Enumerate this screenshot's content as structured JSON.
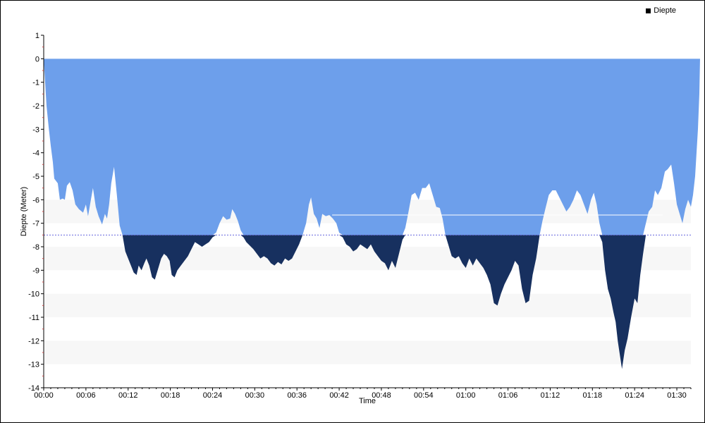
{
  "chart_data": {
    "type": "area",
    "title": "",
    "xlabel": "Time",
    "ylabel": "Diepte (Meter)",
    "legend": {
      "position": "top-right",
      "label": "Diepte"
    },
    "x_unit": "minutes",
    "xlim": [
      0,
      92
    ],
    "ylim": [
      -14,
      1
    ],
    "x_ticks": [
      "00:00",
      "00:06",
      "00:12",
      "00:18",
      "00:24",
      "00:30",
      "00:36",
      "00:42",
      "00:48",
      "00:54",
      "01:00",
      "01:06",
      "01:12",
      "01:18",
      "01:24",
      "01:30"
    ],
    "y_ticks": [
      "1",
      "0",
      "-1",
      "-2",
      "-3",
      "-4",
      "-5",
      "-6",
      "-7",
      "-8",
      "-9",
      "-10",
      "-11",
      "-12",
      "-13",
      "-14"
    ],
    "threshold_line": -7.5,
    "reference_line": {
      "value": -6.65,
      "from": "00:41",
      "to": "01:28"
    },
    "colors": {
      "shallow": "#6d9feb",
      "deep": "#17305f",
      "threshold": "#6666dd",
      "band": "#f7f7f7"
    },
    "series": [
      {
        "name": "Diepte",
        "points": [
          [
            0.0,
            0.0
          ],
          [
            0.2,
            -1.0
          ],
          [
            0.4,
            -2.0
          ],
          [
            0.7,
            -2.9
          ],
          [
            1.0,
            -3.7
          ],
          [
            1.3,
            -4.4
          ],
          [
            1.5,
            -5.1
          ],
          [
            2.0,
            -5.3
          ],
          [
            2.3,
            -6.0
          ],
          [
            2.7,
            -5.95
          ],
          [
            3.0,
            -6.0
          ],
          [
            3.3,
            -5.4
          ],
          [
            3.7,
            -5.25
          ],
          [
            4.1,
            -5.6
          ],
          [
            4.5,
            -6.2
          ],
          [
            5.0,
            -6.4
          ],
          [
            5.6,
            -6.55
          ],
          [
            6.0,
            -6.2
          ],
          [
            6.3,
            -6.7
          ],
          [
            7.0,
            -5.5
          ],
          [
            7.4,
            -6.3
          ],
          [
            7.8,
            -6.7
          ],
          [
            8.3,
            -7.05
          ],
          [
            8.7,
            -6.6
          ],
          [
            9.0,
            -6.8
          ],
          [
            9.3,
            -6.2
          ],
          [
            9.6,
            -5.3
          ],
          [
            10.0,
            -4.6
          ],
          [
            10.4,
            -5.8
          ],
          [
            10.8,
            -7.1
          ],
          [
            11.2,
            -7.5
          ],
          [
            11.6,
            -8.2
          ],
          [
            12.0,
            -8.5
          ],
          [
            12.4,
            -8.8
          ],
          [
            12.8,
            -9.1
          ],
          [
            13.2,
            -9.2
          ],
          [
            13.5,
            -8.8
          ],
          [
            13.9,
            -9.0
          ],
          [
            14.3,
            -8.7
          ],
          [
            14.6,
            -8.5
          ],
          [
            15.0,
            -8.8
          ],
          [
            15.4,
            -9.3
          ],
          [
            15.8,
            -9.4
          ],
          [
            16.2,
            -9.0
          ],
          [
            16.7,
            -8.5
          ],
          [
            17.1,
            -8.3
          ],
          [
            17.5,
            -8.4
          ],
          [
            17.9,
            -8.6
          ],
          [
            18.2,
            -9.2
          ],
          [
            18.6,
            -9.3
          ],
          [
            19.0,
            -9.0
          ],
          [
            19.5,
            -8.8
          ],
          [
            20.0,
            -8.6
          ],
          [
            20.5,
            -8.4
          ],
          [
            21.0,
            -8.1
          ],
          [
            21.5,
            -7.8
          ],
          [
            22.0,
            -7.9
          ],
          [
            22.5,
            -8.0
          ],
          [
            23.0,
            -7.9
          ],
          [
            23.5,
            -7.8
          ],
          [
            24.0,
            -7.6
          ],
          [
            24.5,
            -7.4
          ],
          [
            25.0,
            -7.0
          ],
          [
            25.5,
            -6.7
          ],
          [
            26.0,
            -6.85
          ],
          [
            26.5,
            -6.8
          ],
          [
            26.8,
            -6.4
          ],
          [
            27.2,
            -6.6
          ],
          [
            27.6,
            -6.9
          ],
          [
            28.0,
            -7.3
          ],
          [
            28.4,
            -7.6
          ],
          [
            28.8,
            -7.8
          ],
          [
            29.3,
            -7.95
          ],
          [
            29.8,
            -8.1
          ],
          [
            30.3,
            -8.3
          ],
          [
            30.8,
            -8.5
          ],
          [
            31.3,
            -8.4
          ],
          [
            31.8,
            -8.5
          ],
          [
            32.3,
            -8.7
          ],
          [
            32.8,
            -8.8
          ],
          [
            33.3,
            -8.65
          ],
          [
            33.8,
            -8.75
          ],
          [
            34.3,
            -8.5
          ],
          [
            34.8,
            -8.6
          ],
          [
            35.3,
            -8.5
          ],
          [
            35.8,
            -8.2
          ],
          [
            36.3,
            -7.9
          ],
          [
            36.8,
            -7.5
          ],
          [
            37.3,
            -7.0
          ],
          [
            37.7,
            -6.2
          ],
          [
            38.0,
            -5.9
          ],
          [
            38.4,
            -6.6
          ],
          [
            38.8,
            -6.8
          ],
          [
            39.2,
            -7.2
          ],
          [
            39.6,
            -6.6
          ],
          [
            40.1,
            -6.7
          ],
          [
            40.6,
            -6.65
          ],
          [
            41.1,
            -6.8
          ],
          [
            41.6,
            -7.0
          ],
          [
            42.0,
            -7.4
          ],
          [
            42.5,
            -7.6
          ],
          [
            43.0,
            -7.9
          ],
          [
            43.5,
            -8.0
          ],
          [
            44.0,
            -8.2
          ],
          [
            44.5,
            -8.1
          ],
          [
            45.0,
            -7.9
          ],
          [
            45.5,
            -8.0
          ],
          [
            46.0,
            -8.1
          ],
          [
            46.5,
            -7.9
          ],
          [
            47.0,
            -8.2
          ],
          [
            47.5,
            -8.4
          ],
          [
            48.0,
            -8.6
          ],
          [
            48.5,
            -8.7
          ],
          [
            49.0,
            -9.0
          ],
          [
            49.5,
            -8.6
          ],
          [
            50.0,
            -8.9
          ],
          [
            50.5,
            -8.3
          ],
          [
            51.0,
            -7.7
          ],
          [
            51.4,
            -7.2
          ],
          [
            51.8,
            -6.6
          ],
          [
            52.3,
            -5.8
          ],
          [
            52.8,
            -5.7
          ],
          [
            53.3,
            -6.0
          ],
          [
            53.8,
            -5.5
          ],
          [
            54.3,
            -5.5
          ],
          [
            54.8,
            -5.3
          ],
          [
            55.3,
            -5.8
          ],
          [
            55.8,
            -6.3
          ],
          [
            56.3,
            -6.35
          ],
          [
            56.7,
            -6.8
          ],
          [
            57.1,
            -7.5
          ],
          [
            57.5,
            -7.9
          ],
          [
            58.0,
            -8.4
          ],
          [
            58.5,
            -8.5
          ],
          [
            59.0,
            -8.4
          ],
          [
            59.5,
            -8.7
          ],
          [
            60.0,
            -8.9
          ],
          [
            60.5,
            -8.5
          ],
          [
            61.0,
            -8.8
          ],
          [
            61.5,
            -8.5
          ],
          [
            62.0,
            -8.7
          ],
          [
            62.5,
            -8.9
          ],
          [
            63.0,
            -9.2
          ],
          [
            63.5,
            -9.6
          ],
          [
            64.0,
            -10.4
          ],
          [
            64.5,
            -10.5
          ],
          [
            65.0,
            -10.0
          ],
          [
            65.5,
            -9.6
          ],
          [
            66.0,
            -9.3
          ],
          [
            66.5,
            -9.0
          ],
          [
            67.0,
            -8.6
          ],
          [
            67.5,
            -8.8
          ],
          [
            68.0,
            -9.8
          ],
          [
            68.5,
            -10.4
          ],
          [
            69.0,
            -10.3
          ],
          [
            69.5,
            -9.2
          ],
          [
            70.0,
            -8.5
          ],
          [
            70.5,
            -7.5
          ],
          [
            70.9,
            -6.9
          ],
          [
            71.3,
            -6.4
          ],
          [
            71.8,
            -5.8
          ],
          [
            72.3,
            -5.6
          ],
          [
            72.8,
            -5.6
          ],
          [
            73.3,
            -5.9
          ],
          [
            73.8,
            -6.2
          ],
          [
            74.3,
            -6.5
          ],
          [
            74.8,
            -6.3
          ],
          [
            75.3,
            -6.0
          ],
          [
            75.8,
            -5.6
          ],
          [
            76.3,
            -5.8
          ],
          [
            76.8,
            -6.2
          ],
          [
            77.3,
            -6.6
          ],
          [
            77.8,
            -6.0
          ],
          [
            78.2,
            -5.7
          ],
          [
            78.6,
            -6.2
          ],
          [
            79.0,
            -7.0
          ],
          [
            79.4,
            -7.8
          ],
          [
            79.8,
            -9.0
          ],
          [
            80.2,
            -9.8
          ],
          [
            80.6,
            -10.2
          ],
          [
            81.0,
            -10.8
          ],
          [
            81.3,
            -11.2
          ],
          [
            81.6,
            -12.0
          ],
          [
            81.9,
            -12.6
          ],
          [
            82.2,
            -13.2
          ],
          [
            82.6,
            -12.4
          ],
          [
            83.0,
            -11.9
          ],
          [
            83.5,
            -11.0
          ],
          [
            84.0,
            -10.2
          ],
          [
            84.4,
            -10.4
          ],
          [
            84.8,
            -9.2
          ],
          [
            85.2,
            -8.3
          ],
          [
            85.6,
            -7.0
          ],
          [
            86.0,
            -6.5
          ],
          [
            86.5,
            -6.3
          ],
          [
            86.9,
            -5.6
          ],
          [
            87.3,
            -5.8
          ],
          [
            87.8,
            -5.5
          ],
          [
            88.3,
            -4.8
          ],
          [
            88.7,
            -4.7
          ],
          [
            89.2,
            -4.5
          ],
          [
            89.6,
            -5.3
          ],
          [
            90.0,
            -6.2
          ],
          [
            90.4,
            -6.6
          ],
          [
            90.8,
            -7.0
          ],
          [
            91.2,
            -6.4
          ],
          [
            91.6,
            -6.0
          ],
          [
            92.0,
            -6.3
          ],
          [
            92.3,
            -5.8
          ],
          [
            92.6,
            -5.0
          ],
          [
            93.0,
            -3.0
          ],
          [
            93.2,
            -1.5
          ],
          [
            93.3,
            0.0
          ]
        ]
      }
    ]
  }
}
